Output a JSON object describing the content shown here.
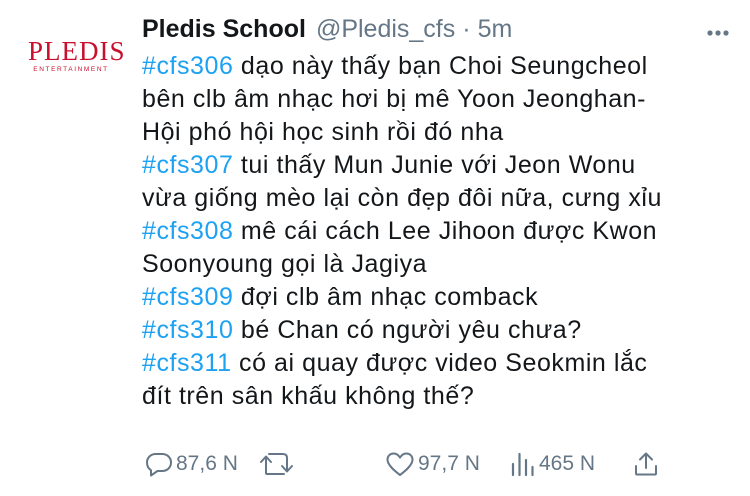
{
  "avatar": {
    "brand": "PLEDIS",
    "sub": "ENTERTAINMENT"
  },
  "tweet": {
    "display_name": "Pledis School",
    "handle": "@Pledis_cfs",
    "separator": "·",
    "time": "5m",
    "lines": [
      {
        "tag": "#cfs306",
        "text": " dạo này thấy bạn Choi Seungcheol"
      },
      {
        "tag": "",
        "text": "bên clb âm nhạc hơi bị mê Yoon Jeonghan-"
      },
      {
        "tag": "",
        "text": "Hội phó hội học sinh rồi đó nha"
      },
      {
        "tag": "#cfs307",
        "text": " tui thấy Mun Junie với Jeon Wonu"
      },
      {
        "tag": "",
        "text": "vừa giống mèo lại còn đẹp đôi nữa, cưng xỉu"
      },
      {
        "tag": "#cfs308",
        "text": " mê cái cách Lee Jihoon được Kwon"
      },
      {
        "tag": "",
        "text": "Soonyoung gọi là Jagiya"
      },
      {
        "tag": "#cfs309",
        "text": " đợi clb âm nhạc comback"
      },
      {
        "tag": "#cfs310",
        "text": " bé Chan có người yêu chưa?"
      },
      {
        "tag": "#cfs311",
        "text": " có ai quay được video Seokmin lắc"
      },
      {
        "tag": "",
        "text": "đít trên sân khấu không thế?"
      }
    ]
  },
  "actions": {
    "reply_count": "87,6 N",
    "like_count": "97,7 N",
    "views_count": "465 N"
  },
  "icons": {
    "avatar": "pledis-logo",
    "more": "more-dots-icon",
    "reply": "reply-bubble-icon",
    "retweet": "retweet-icon",
    "like": "heart-icon",
    "views": "views-bars-icon",
    "share": "share-icon"
  },
  "colors": {
    "hashtag": "#1da1f2",
    "secondary_text": "#657786",
    "brand_red": "#c8102e"
  }
}
